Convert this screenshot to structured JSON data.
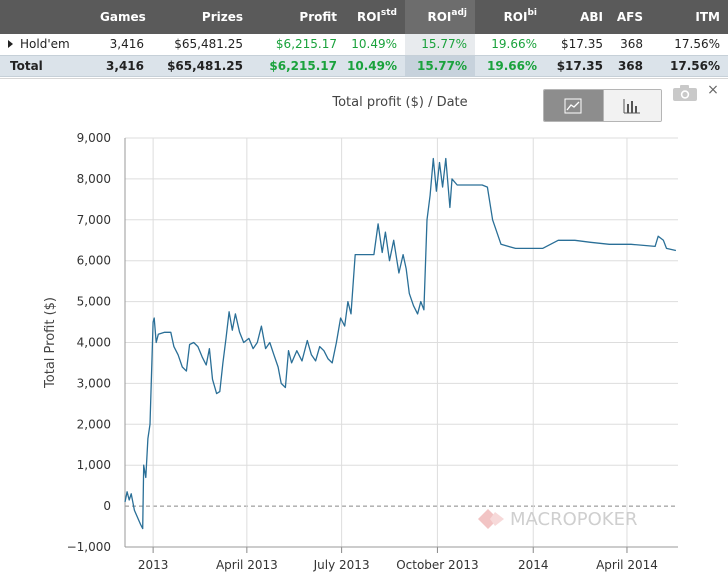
{
  "stats_table": {
    "headers": {
      "game": "",
      "games": "Games",
      "prizes": "Prizes",
      "profit": "Profit",
      "roi_std": "ROI",
      "roi_std_sup": "std",
      "roi_adj": "ROI",
      "roi_adj_sup": "adj",
      "roi_bi": "ROI",
      "roi_bi_sup": "bi",
      "abi": "ABI",
      "afs": "AFS",
      "itm": "ITM"
    },
    "rows": [
      {
        "game": "Hold'em",
        "games": "3,416",
        "prizes": "$65,481.25",
        "profit": "$6,215.17",
        "roi_std": "10.49%",
        "roi_adj": "15.77%",
        "roi_bi": "19.66%",
        "abi": "$17.35",
        "afs": "368",
        "itm": "17.56%"
      }
    ],
    "total": {
      "game": "Total",
      "games": "3,416",
      "prizes": "$65,481.25",
      "profit": "$6,215.17",
      "roi_std": "10.49%",
      "roi_adj": "15.77%",
      "roi_bi": "19.66%",
      "abi": "$17.35",
      "afs": "368",
      "itm": "17.56%"
    }
  },
  "controls": {
    "line_view_icon": "line-chart-icon",
    "bar_view_icon": "bar-chart-icon",
    "camera_icon": "camera-icon",
    "close_glyph": "×"
  },
  "watermark": {
    "logo_icon": "macropoker-logo-icon",
    "text": "MACROPOKER"
  },
  "colors": {
    "line": "#2a6f97",
    "green_text": "#1aa23c",
    "header_bg": "#5a5a5a"
  },
  "chart_data": {
    "type": "line",
    "title": "Total profit ($) / Date",
    "xlabel": "",
    "ylabel": "Total Profit ($)",
    "ylim": [
      -1000,
      9000
    ],
    "yticks": [
      -1000,
      0,
      1000,
      2000,
      3000,
      4000,
      5000,
      6000,
      7000,
      8000,
      9000
    ],
    "ytick_labels": [
      "−1,000",
      "0",
      "1,000",
      "2,000",
      "3,000",
      "4,000",
      "5,000",
      "6,000",
      "7,000",
      "8,000",
      "9,000"
    ],
    "xlim": [
      "2012-12-05",
      "2014-05-20"
    ],
    "xticks": [
      {
        "date": "2013-01-01",
        "label": "2013"
      },
      {
        "date": "2013-04-01",
        "label": "April 2013"
      },
      {
        "date": "2013-07-01",
        "label": "July 2013"
      },
      {
        "date": "2013-10-01",
        "label": "October 2013"
      },
      {
        "date": "2014-01-01",
        "label": "2014"
      },
      {
        "date": "2014-04-01",
        "label": "April 2014"
      }
    ],
    "grid": true,
    "series": [
      {
        "points": [
          [
            "2012-12-05",
            100
          ],
          [
            "2012-12-07",
            350
          ],
          [
            "2012-12-09",
            150
          ],
          [
            "2012-12-11",
            300
          ],
          [
            "2012-12-14",
            -100
          ],
          [
            "2012-12-20",
            -450
          ],
          [
            "2012-12-22",
            -550
          ],
          [
            "2012-12-23",
            1000
          ],
          [
            "2012-12-25",
            700
          ],
          [
            "2012-12-27",
            1650
          ],
          [
            "2012-12-29",
            2000
          ],
          [
            "2013-01-01",
            4500
          ],
          [
            "2013-01-02",
            4600
          ],
          [
            "2013-01-04",
            4000
          ],
          [
            "2013-01-06",
            4200
          ],
          [
            "2013-01-12",
            4250
          ],
          [
            "2013-01-18",
            4250
          ],
          [
            "2013-01-21",
            3900
          ],
          [
            "2013-01-25",
            3700
          ],
          [
            "2013-01-29",
            3400
          ],
          [
            "2013-02-02",
            3300
          ],
          [
            "2013-02-05",
            3950
          ],
          [
            "2013-02-09",
            4000
          ],
          [
            "2013-02-13",
            3900
          ],
          [
            "2013-02-17",
            3650
          ],
          [
            "2013-02-21",
            3450
          ],
          [
            "2013-02-24",
            3850
          ],
          [
            "2013-02-27",
            3100
          ],
          [
            "2013-03-03",
            2750
          ],
          [
            "2013-03-06",
            2800
          ],
          [
            "2013-03-09",
            3500
          ],
          [
            "2013-03-12",
            4100
          ],
          [
            "2013-03-15",
            4750
          ],
          [
            "2013-03-18",
            4300
          ],
          [
            "2013-03-21",
            4700
          ],
          [
            "2013-03-25",
            4250
          ],
          [
            "2013-03-29",
            4000
          ],
          [
            "2013-04-03",
            4100
          ],
          [
            "2013-04-07",
            3850
          ],
          [
            "2013-04-11",
            4000
          ],
          [
            "2013-04-15",
            4400
          ],
          [
            "2013-04-19",
            3850
          ],
          [
            "2013-04-23",
            4000
          ],
          [
            "2013-04-27",
            3700
          ],
          [
            "2013-05-01",
            3400
          ],
          [
            "2013-05-04",
            3000
          ],
          [
            "2013-05-08",
            2900
          ],
          [
            "2013-05-11",
            3800
          ],
          [
            "2013-05-14",
            3500
          ],
          [
            "2013-05-19",
            3800
          ],
          [
            "2013-05-24",
            3550
          ],
          [
            "2013-05-29",
            4050
          ],
          [
            "2013-06-02",
            3700
          ],
          [
            "2013-06-06",
            3550
          ],
          [
            "2013-06-10",
            3900
          ],
          [
            "2013-06-14",
            3800
          ],
          [
            "2013-06-18",
            3600
          ],
          [
            "2013-06-22",
            3500
          ],
          [
            "2013-06-26",
            4000
          ],
          [
            "2013-06-30",
            4600
          ],
          [
            "2013-07-04",
            4400
          ],
          [
            "2013-07-07",
            5000
          ],
          [
            "2013-07-10",
            4700
          ],
          [
            "2013-07-14",
            6150
          ],
          [
            "2013-07-20",
            6150
          ],
          [
            "2013-07-26",
            6150
          ],
          [
            "2013-08-01",
            6150
          ],
          [
            "2013-08-05",
            6900
          ],
          [
            "2013-08-09",
            6200
          ],
          [
            "2013-08-12",
            6700
          ],
          [
            "2013-08-16",
            6000
          ],
          [
            "2013-08-20",
            6500
          ],
          [
            "2013-08-25",
            5700
          ],
          [
            "2013-08-29",
            6150
          ],
          [
            "2013-09-01",
            5800
          ],
          [
            "2013-09-04",
            5200
          ],
          [
            "2013-09-08",
            4900
          ],
          [
            "2013-09-12",
            4700
          ],
          [
            "2013-09-15",
            5000
          ],
          [
            "2013-09-18",
            4800
          ],
          [
            "2013-09-21",
            7000
          ],
          [
            "2013-09-24",
            7600
          ],
          [
            "2013-09-27",
            8500
          ],
          [
            "2013-09-30",
            7700
          ],
          [
            "2013-10-03",
            8400
          ],
          [
            "2013-10-06",
            7800
          ],
          [
            "2013-10-09",
            8500
          ],
          [
            "2013-10-13",
            7300
          ],
          [
            "2013-10-15",
            8000
          ],
          [
            "2013-10-20",
            7850
          ],
          [
            "2013-10-28",
            7850
          ],
          [
            "2013-11-06",
            7850
          ],
          [
            "2013-11-13",
            7850
          ],
          [
            "2013-11-18",
            7800
          ],
          [
            "2013-11-23",
            7000
          ],
          [
            "2013-12-01",
            6400
          ],
          [
            "2013-12-15",
            6300
          ],
          [
            "2014-01-01",
            6300
          ],
          [
            "2014-01-10",
            6300
          ],
          [
            "2014-01-25",
            6500
          ],
          [
            "2014-02-10",
            6500
          ],
          [
            "2014-02-25",
            6450
          ],
          [
            "2014-03-15",
            6400
          ],
          [
            "2014-04-05",
            6400
          ],
          [
            "2014-04-28",
            6350
          ],
          [
            "2014-05-01",
            6600
          ],
          [
            "2014-05-06",
            6500
          ],
          [
            "2014-05-09",
            6300
          ],
          [
            "2014-05-18",
            6250
          ]
        ]
      }
    ]
  }
}
